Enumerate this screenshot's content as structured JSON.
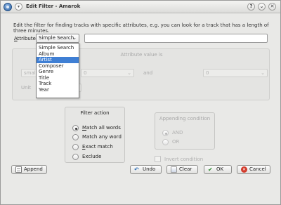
{
  "window": {
    "title": "Edit Filter - Amarok",
    "help_glyph": "?",
    "minimize_glyph": "⌄",
    "close_glyph": "✕",
    "menu_glyph": "▾"
  },
  "description": "Edit the filter for finding tracks with specific attributes, e.g. you can look for a track that has a length of three minutes.",
  "attribute": {
    "label_mnemonic": "A",
    "label_rest": "ttribute:",
    "selected": "Simple Search",
    "options": [
      "Simple Search",
      "Album",
      "Artist",
      "Composer",
      "Genre",
      "Title",
      "Track",
      "Year"
    ],
    "highlighted": "Artist",
    "text_value": ""
  },
  "value_panel": {
    "title": "Attribute value is",
    "combo1": "smal",
    "spin1": "0",
    "and_label": "and",
    "spin2": "0",
    "unit_label": "Unit"
  },
  "filter_action": {
    "title": "Filter action",
    "options": [
      {
        "mnemonic": "M",
        "rest": "atch all words",
        "checked": true
      },
      {
        "mnemonic": "",
        "rest": "Match any word",
        "checked": false
      },
      {
        "mnemonic": "E",
        "rest": "xact match",
        "checked": false
      },
      {
        "mnemonic": "",
        "rest": "Exclude",
        "checked": false
      }
    ]
  },
  "appending": {
    "title": "Appending condition",
    "and_label": "AND",
    "or_label": "OR",
    "invert_label": "Invert condition"
  },
  "buttons": {
    "append": "Append",
    "undo": "Undo",
    "clear": "Clear",
    "ok": "OK",
    "cancel": "Cancel"
  },
  "colors": {
    "selection": "#3f7fd4",
    "window_bg": "#e9e9e7"
  }
}
